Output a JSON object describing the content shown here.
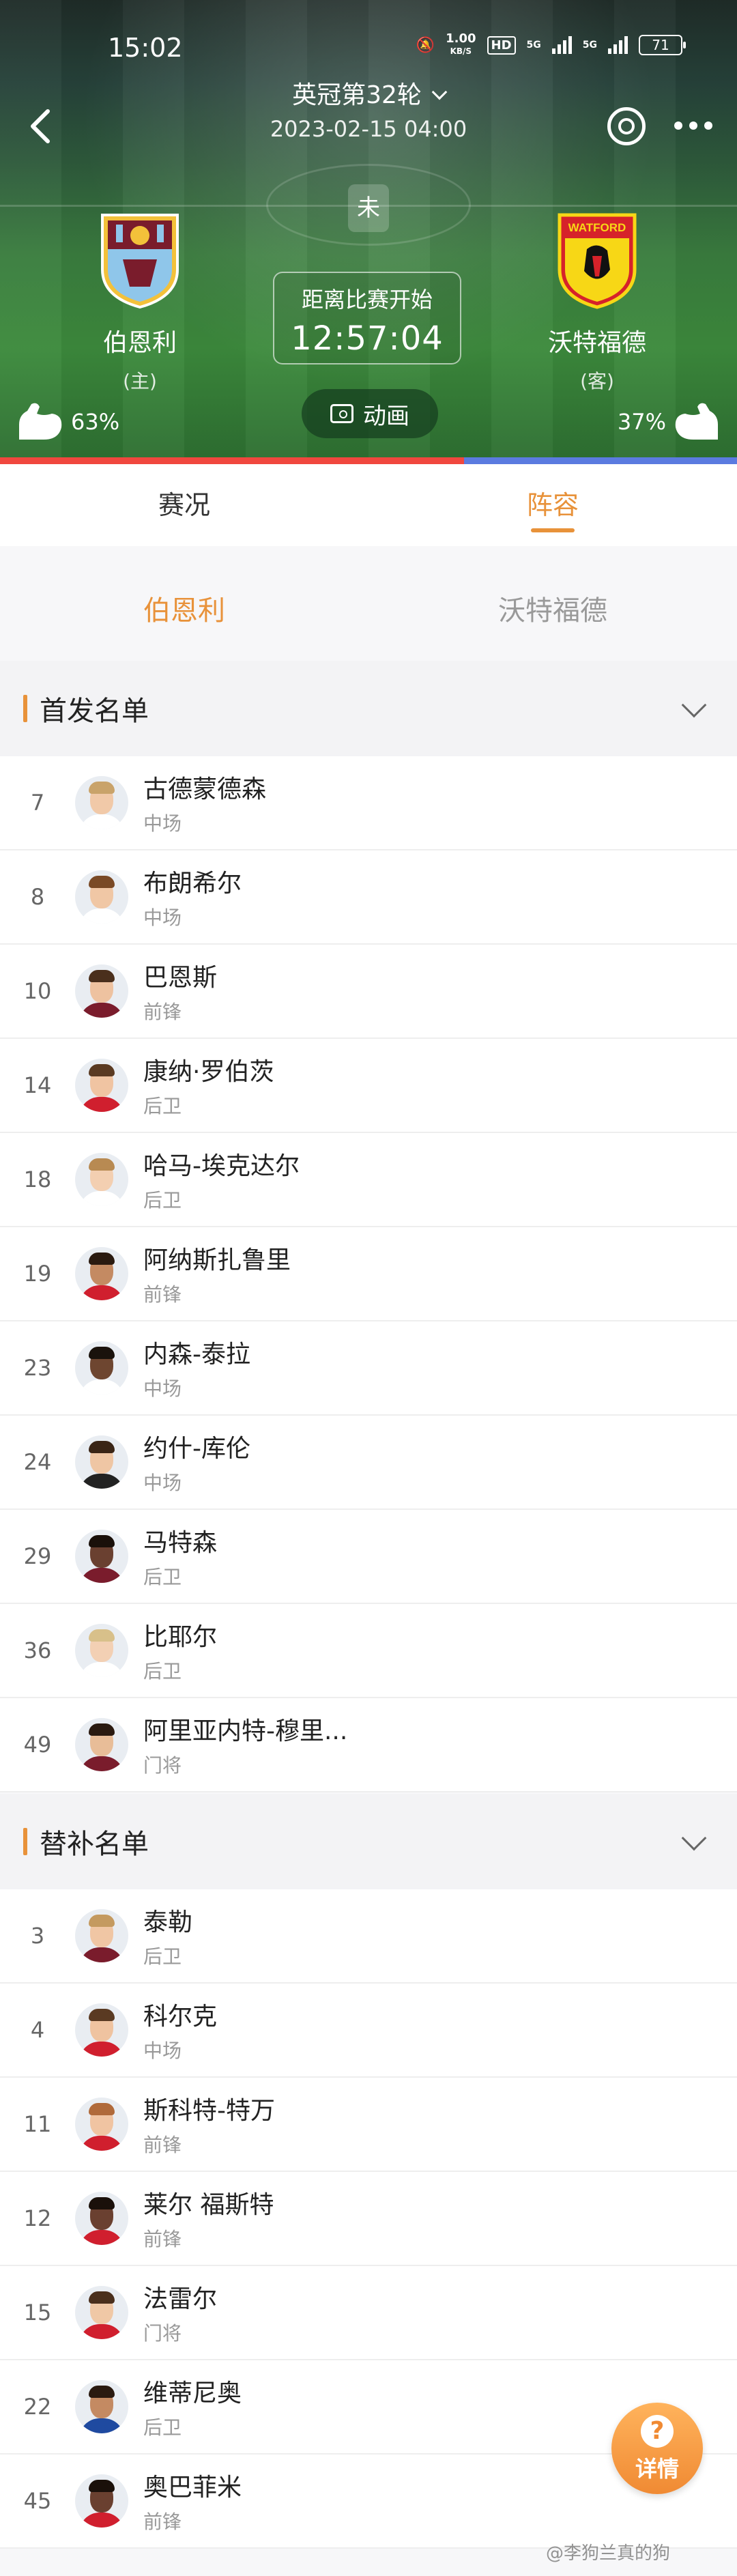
{
  "status_bar": {
    "time": "15:02",
    "net_speed": "1.00",
    "net_unit": "KB/S",
    "hd": "HD",
    "sig1": "5G",
    "sig2": "5G",
    "battery": "71"
  },
  "header": {
    "league": "英冠第32轮",
    "datetime": "2023-02-15 04:00",
    "match_status": "未",
    "countdown_label": "距离比赛开始",
    "countdown": "12:57:04",
    "animation_label": "动画",
    "home": {
      "name": "伯恩利",
      "role": "(主)",
      "strength": "63%"
    },
    "away": {
      "name": "沃特福德",
      "role": "(客)",
      "strength": "37%",
      "badge_text": "WATFORD"
    },
    "strength_home_fraction": 0.63
  },
  "tabs": {
    "items": [
      {
        "label": "赛况"
      },
      {
        "label": "阵容"
      }
    ],
    "active": "阵容"
  },
  "team_tabs": [
    {
      "label": "伯恩利"
    },
    {
      "label": "沃特福德"
    }
  ],
  "starters": {
    "title": "首发名单",
    "players": [
      {
        "num": "7",
        "name": "古德蒙德森",
        "pos": "中场",
        "skin": "#f1c9a8",
        "hair": "#c9a36a",
        "shirt": "#ffffff"
      },
      {
        "num": "8",
        "name": "布朗希尔",
        "pos": "中场",
        "skin": "#f0c7a5",
        "hair": "#7a4a26",
        "shirt": "#ffffff"
      },
      {
        "num": "10",
        "name": "巴恩斯",
        "pos": "前锋",
        "skin": "#eec2a0",
        "hair": "#4a2f1c",
        "shirt": "#7a1c2c"
      },
      {
        "num": "14",
        "name": "康纳·罗伯茨",
        "pos": "后卫",
        "skin": "#f0c4a2",
        "hair": "#5a3a22",
        "shirt": "#d01f2e"
      },
      {
        "num": "18",
        "name": "哈马-埃克达尔",
        "pos": "后卫",
        "skin": "#f3cfb1",
        "hair": "#b88a52",
        "shirt": "#ffffff"
      },
      {
        "num": "19",
        "name": "阿纳斯扎鲁里",
        "pos": "前锋",
        "skin": "#c48a62",
        "hair": "#2a1a10",
        "shirt": "#d01f2e"
      },
      {
        "num": "23",
        "name": "内森-泰拉",
        "pos": "中场",
        "skin": "#6e4630",
        "hair": "#1a120c",
        "shirt": "#ffffff"
      },
      {
        "num": "24",
        "name": "约什-库伦",
        "pos": "中场",
        "skin": "#efc6a4",
        "hair": "#3a2516",
        "shirt": "#222222"
      },
      {
        "num": "29",
        "name": "马特森",
        "pos": "后卫",
        "skin": "#6a4030",
        "hair": "#1a100a",
        "shirt": "#7a1c2c"
      },
      {
        "num": "36",
        "name": "比耶尔",
        "pos": "后卫",
        "skin": "#f3d0b4",
        "hair": "#d8c08a",
        "shirt": "#ffffff"
      },
      {
        "num": "49",
        "name": "阿里亚内特-穆里...",
        "pos": "门将",
        "skin": "#e8bd98",
        "hair": "#2a1a10",
        "shirt": "#7a1c2c"
      }
    ]
  },
  "subs": {
    "title": "替补名单",
    "players": [
      {
        "num": "3",
        "name": "泰勒",
        "pos": "后卫",
        "skin": "#f0c6a4",
        "hair": "#c49a60",
        "shirt": "#7a1c2c"
      },
      {
        "num": "4",
        "name": "科尔克",
        "pos": "中场",
        "skin": "#efc3a0",
        "hair": "#5a3a22",
        "shirt": "#d01f2e"
      },
      {
        "num": "11",
        "name": "斯科特-特万",
        "pos": "前锋",
        "skin": "#f0c4a2",
        "hair": "#b06a3a",
        "shirt": "#d01f2e"
      },
      {
        "num": "12",
        "name": "莱尔 福斯特",
        "pos": "前锋",
        "skin": "#6a4030",
        "hair": "#1a100a",
        "shirt": "#d01f2e"
      },
      {
        "num": "15",
        "name": "法雷尔",
        "pos": "门将",
        "skin": "#f0c8a6",
        "hair": "#4a2f1c",
        "shirt": "#d01f2e"
      },
      {
        "num": "22",
        "name": "维蒂尼奥",
        "pos": "后卫",
        "skin": "#c48a62",
        "hair": "#2a1a10",
        "shirt": "#1f4aa0"
      },
      {
        "num": "45",
        "name": "奥巴菲米",
        "pos": "前锋",
        "skin": "#6a4030",
        "hair": "#1a100a",
        "shirt": "#d01f2e"
      }
    ]
  },
  "fab": {
    "icon": "?",
    "label": "详情"
  },
  "watermark": "@李狗兰真的狗",
  "colors": {
    "accent": "#e8923a",
    "home_bar": "#f0473e",
    "away_bar": "#5b7be0"
  }
}
